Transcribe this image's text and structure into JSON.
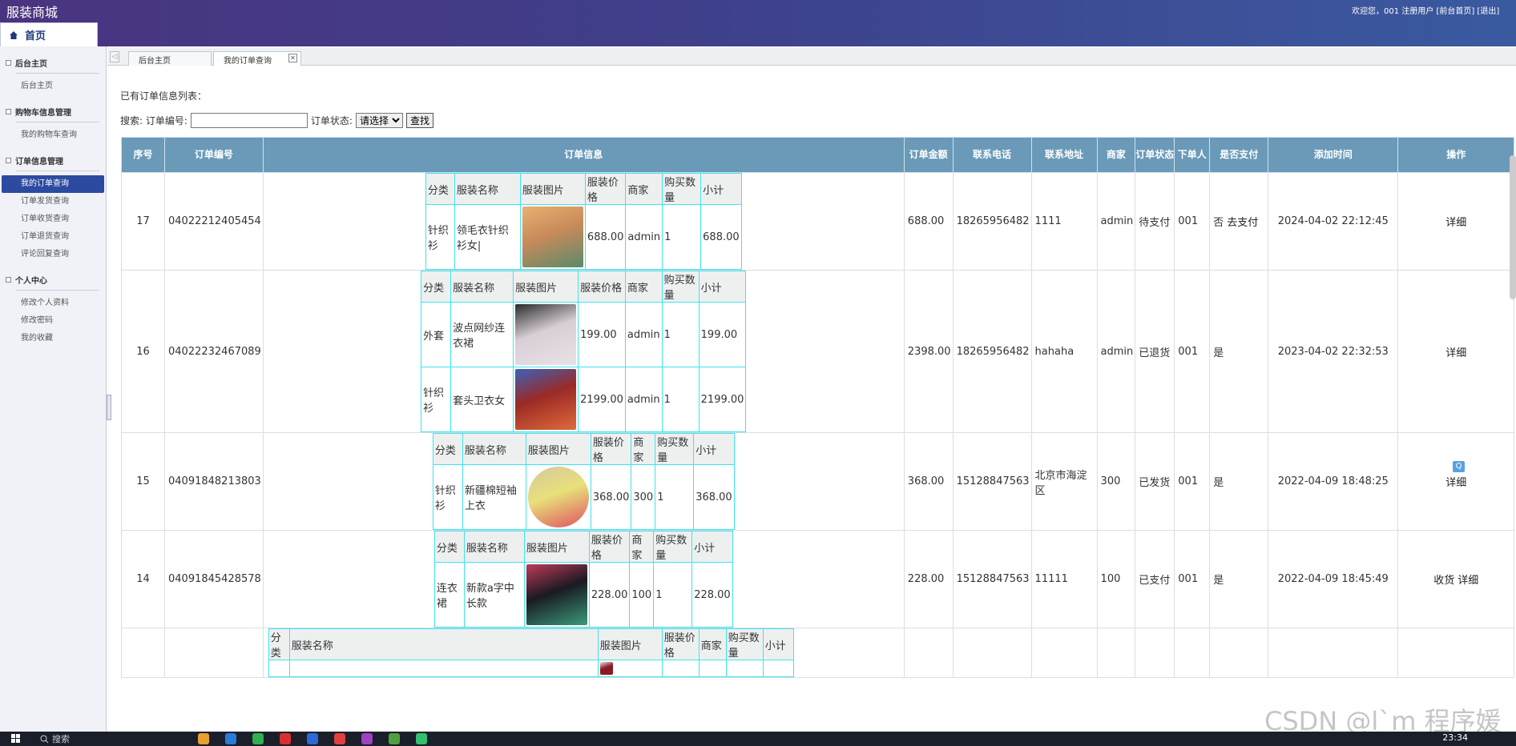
{
  "header": {
    "brand": "服装商城",
    "welcome": "欢迎您，001 注册用户 [前台首页] [退出]",
    "home_tab": "首页"
  },
  "sidebar": {
    "groups": [
      {
        "title": "后台主页",
        "items": [
          {
            "label": "后台主页"
          }
        ]
      },
      {
        "title": "购物车信息管理",
        "items": [
          {
            "label": "我的购物车查询"
          }
        ]
      },
      {
        "title": "订单信息管理",
        "items": [
          {
            "label": "我的订单查询",
            "active": true
          },
          {
            "label": "订单发货查询"
          },
          {
            "label": "订单收货查询"
          },
          {
            "label": "订单退货查询"
          },
          {
            "label": "评论回复查询"
          }
        ]
      },
      {
        "title": "个人中心",
        "items": [
          {
            "label": "修改个人资料"
          },
          {
            "label": "修改密码"
          },
          {
            "label": "我的收藏"
          }
        ]
      }
    ]
  },
  "tabs": [
    {
      "label": "后台主页"
    },
    {
      "label": "我的订单查询"
    }
  ],
  "page": {
    "list_title": "已有订单信息列表：",
    "search_label": "搜索: 订单编号:",
    "status_label": "订单状态:",
    "status_selected": "请选择",
    "search_button": "查找"
  },
  "columns": [
    "序号",
    "订单编号",
    "订单信息",
    "订单金额",
    "联系电话",
    "联系地址",
    "商家",
    "订单状态",
    "下单人",
    "是否支付",
    "添加时间",
    "操作"
  ],
  "inner_columns": [
    "分类",
    "服装名称",
    "服装图片",
    "服装价格",
    "商家",
    "购买数量",
    "小计"
  ],
  "orders": [
    {
      "no": "17",
      "order_no": "04022212405454",
      "amount": "688.00",
      "phone": "18265956482",
      "address": "1111",
      "merchant": "admin",
      "status": "待支付",
      "buyer": "001",
      "paid": "否",
      "pay_link": "去支付",
      "time": "2024-04-02 22:12:45",
      "actions": [
        "详细"
      ],
      "items": [
        {
          "category": "针织衫",
          "name": "领毛衣针织衫女|",
          "price": "688.00",
          "merchant": "admin",
          "qty": "1",
          "subtotal": "688.00",
          "img": [
            "#c98a5a",
            "#e8b070",
            "#5a8a6a"
          ]
        }
      ]
    },
    {
      "no": "16",
      "order_no": "04022232467089",
      "amount": "2398.00",
      "phone": "18265956482",
      "address": "hahaha",
      "merchant": "admin",
      "status": "已退货",
      "buyer": "001",
      "paid": "是",
      "time": "2023-04-02 22:32:53",
      "actions": [
        "详细"
      ],
      "items": [
        {
          "category": "外套",
          "name": "波点网纱连衣裙",
          "price": "199.00",
          "merchant": "admin",
          "qty": "1",
          "subtotal": "199.00",
          "img": [
            "#d8cfd6",
            "#2a2a2a",
            "#e8e2e6"
          ]
        },
        {
          "category": "针织衫",
          "name": "套头卫衣女",
          "price": "2199.00",
          "merchant": "admin",
          "qty": "1",
          "subtotal": "2199.00",
          "img": [
            "#9a2a26",
            "#3a62b8",
            "#e06a3a"
          ]
        }
      ]
    },
    {
      "no": "15",
      "order_no": "04091848213803",
      "amount": "368.00",
      "phone": "15128847563",
      "address": "北京市海淀区",
      "merchant": "300",
      "status": "已发货",
      "buyer": "001",
      "paid": "是",
      "time": "2022-04-09 18:48:25",
      "actions": [
        "详细"
      ],
      "items": [
        {
          "category": "针织衫",
          "name": "新疆棉短袖上衣",
          "price": "368.00",
          "merchant": "300",
          "qty": "1",
          "subtotal": "368.00",
          "img": [
            "#e8e07a",
            "#d8c6a0",
            "#e05060"
          ]
        }
      ]
    },
    {
      "no": "14",
      "order_no": "04091845428578",
      "amount": "228.00",
      "phone": "15128847563",
      "address": "11111",
      "merchant": "100",
      "status": "已支付",
      "buyer": "001",
      "paid": "是",
      "time": "2022-04-09 18:45:49",
      "actions": [
        "收货",
        "详细"
      ],
      "items": [
        {
          "category": "连衣裙",
          "name": "新款a字中长款",
          "price": "228.00",
          "merchant": "100",
          "qty": "1",
          "subtotal": "228.00",
          "img": [
            "#1a1a22",
            "#c03a5a",
            "#3a9a7a"
          ]
        }
      ]
    },
    {
      "no": "",
      "order_no": "",
      "amount": "",
      "phone": "",
      "address": "",
      "merchant": "",
      "status": "",
      "buyer": "",
      "paid": "",
      "time": "",
      "actions": [],
      "items": [
        {
          "category": "",
          "name": "",
          "price": "",
          "merchant": "",
          "qty": "",
          "subtotal": "",
          "img": [
            "#8a1a24",
            "#f0e0e0",
            "#8a1a24"
          ]
        }
      ]
    }
  ],
  "taskbar": {
    "search": "搜索",
    "time": "23:34"
  },
  "watermark": "CSDN @l`m 程序媛",
  "float_icon": "Q"
}
